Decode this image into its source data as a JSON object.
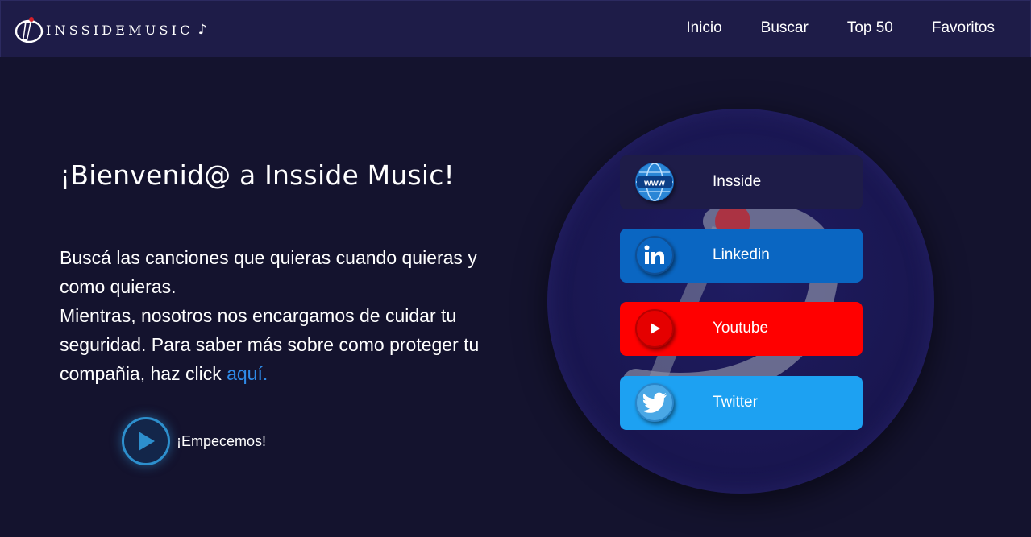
{
  "brand": {
    "name": "INSSIDEMUSIC",
    "note_glyph": "♪"
  },
  "nav": {
    "items": [
      {
        "label": "Inicio"
      },
      {
        "label": "Buscar"
      },
      {
        "label": "Top 50"
      },
      {
        "label": "Favoritos"
      }
    ]
  },
  "hero": {
    "title": "¡Bienvenid@ a Insside Music!",
    "paragraph_line1": "Buscá las canciones que quieras cuando quieras y como quieras.",
    "paragraph_line2": "Mientras, nosotros nos encargamos de cuidar tu seguridad. Para saber más sobre como proteger tu compañia, haz click ",
    "link_text": "aquí.",
    "start_label": "¡Empecemos!"
  },
  "social": {
    "items": [
      {
        "label": "Insside",
        "icon": "www-globe-icon",
        "color": "#1e1c48"
      },
      {
        "label": "Linkedin",
        "icon": "linkedin-icon",
        "color": "#0a66c2"
      },
      {
        "label": "Youtube",
        "icon": "youtube-icon",
        "color": "#ff0000"
      },
      {
        "label": "Twitter",
        "icon": "twitter-icon",
        "color": "#1da1f2"
      }
    ]
  },
  "colors": {
    "background": "#14132e",
    "navbar": "#1e1c48",
    "link": "#2f8be8",
    "play_ring": "#2d8fcd"
  }
}
